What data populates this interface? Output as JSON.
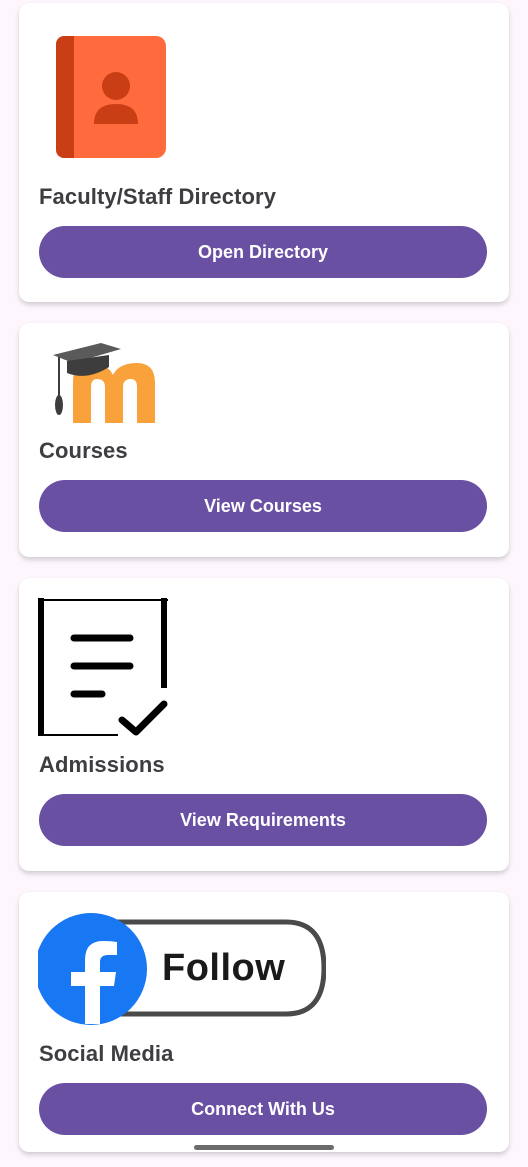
{
  "cards": [
    {
      "title": "Faculty/Staff Directory",
      "button": "Open Directory",
      "icon": "contact-book-icon"
    },
    {
      "title": "Courses",
      "button": "View Courses",
      "icon": "moodle-logo-icon"
    },
    {
      "title": "Admissions",
      "button": "View Requirements",
      "icon": "document-check-icon"
    },
    {
      "title": "Social Media",
      "button": "Connect With Us",
      "icon": "facebook-follow-icon",
      "badge_text": "Follow"
    }
  ],
  "colors": {
    "accent": "#6950a3",
    "directory_icon": "#ff6b3d",
    "moodle": "#f9a23b",
    "facebook": "#1877f2"
  }
}
